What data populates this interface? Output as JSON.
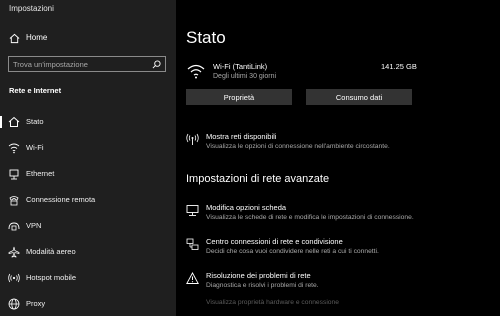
{
  "window": {
    "title": "Impostazioni"
  },
  "sidebar": {
    "home_label": "Home",
    "search_placeholder": "Trova un'impostazione",
    "section_title": "Rete e Internet",
    "items": [
      {
        "label": "Stato",
        "icon": "home-status-icon",
        "active": true
      },
      {
        "label": "Wi-Fi",
        "icon": "wifi-icon"
      },
      {
        "label": "Ethernet",
        "icon": "ethernet-icon"
      },
      {
        "label": "Connessione remota",
        "icon": "dial-up-icon"
      },
      {
        "label": "VPN",
        "icon": "vpn-icon"
      },
      {
        "label": "Modalità aereo",
        "icon": "airplane-icon"
      },
      {
        "label": "Hotspot mobile",
        "icon": "hotspot-icon"
      },
      {
        "label": "Proxy",
        "icon": "globe-icon"
      }
    ]
  },
  "main": {
    "title": "Stato",
    "connection": {
      "name": "Wi-Fi (TantiLink)",
      "subtitle": "Degli ultimi 30 giorni",
      "data_used": "141.25 GB"
    },
    "buttons": {
      "properties": "Proprietà",
      "data_usage": "Consumo dati"
    },
    "show_networks": {
      "title": "Mostra reti disponibili",
      "desc": "Visualizza le opzioni di connessione nell'ambiente circostante."
    },
    "advanced_title": "Impostazioni di rete avanzate",
    "advanced_items": [
      {
        "title": "Modifica opzioni scheda",
        "desc": "Visualizza le schede di rete e modifica le impostazioni di connessione."
      },
      {
        "title": "Centro connessioni di rete e condivisione",
        "desc": "Decidi che cosa vuoi condividere nelle reti a cui ti connetti."
      },
      {
        "title": "Risoluzione dei problemi di rete",
        "desc": "Diagnostica e risolvi i problemi di rete."
      }
    ],
    "hardware_link": "Visualizza proprietà hardware e connessione"
  }
}
